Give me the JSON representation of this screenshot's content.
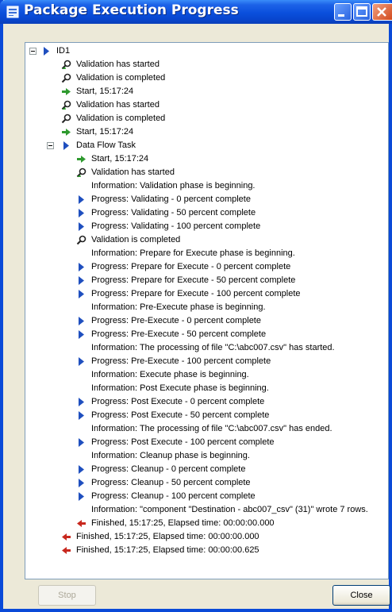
{
  "window": {
    "title": "Package Execution Progress"
  },
  "buttons": {
    "stop": "Stop",
    "close": "Close"
  },
  "tree": [
    {
      "icon": "expander-minus",
      "arrow": "blue-arrow-icon",
      "text": "ID1"
    },
    {
      "icon": "validation-start-icon",
      "text": "Validation has started"
    },
    {
      "icon": "validation-complete-icon",
      "text": "Validation is completed"
    },
    {
      "icon": "start-arrow-icon",
      "text": "Start, 15:17:24"
    },
    {
      "icon": "validation-start-icon",
      "text": "Validation has started"
    },
    {
      "icon": "validation-complete-icon",
      "text": "Validation is completed"
    },
    {
      "icon": "start-arrow-icon",
      "text": "Start, 15:17:24"
    },
    {
      "icon": "expander-minus",
      "arrow": "blue-arrow-icon",
      "text": "Data Flow Task"
    },
    {
      "icon": "start-arrow-icon",
      "text": "Start, 15:17:24"
    },
    {
      "icon": "validation-start-icon",
      "text": "Validation has started"
    },
    {
      "icon": "none",
      "text": "Information: Validation phase is beginning."
    },
    {
      "icon": "progress-arrow-icon",
      "text": "Progress: Validating - 0 percent complete"
    },
    {
      "icon": "progress-arrow-icon",
      "text": "Progress: Validating - 50 percent complete"
    },
    {
      "icon": "progress-arrow-icon",
      "text": "Progress: Validating - 100 percent complete"
    },
    {
      "icon": "validation-complete-icon",
      "text": "Validation is completed"
    },
    {
      "icon": "none",
      "text": "Information: Prepare for Execute phase is beginning."
    },
    {
      "icon": "progress-arrow-icon",
      "text": "Progress: Prepare for Execute - 0 percent complete"
    },
    {
      "icon": "progress-arrow-icon",
      "text": "Progress: Prepare for Execute - 50 percent complete"
    },
    {
      "icon": "progress-arrow-icon",
      "text": "Progress: Prepare for Execute - 100 percent complete"
    },
    {
      "icon": "none",
      "text": "Information: Pre-Execute phase is beginning."
    },
    {
      "icon": "progress-arrow-icon",
      "text": "Progress: Pre-Execute - 0 percent complete"
    },
    {
      "icon": "progress-arrow-icon",
      "text": "Progress: Pre-Execute - 50 percent complete"
    },
    {
      "icon": "none",
      "text": "Information: The processing of file \"C:\\abc007.csv\" has started."
    },
    {
      "icon": "progress-arrow-icon",
      "text": "Progress: Pre-Execute - 100 percent complete"
    },
    {
      "icon": "none",
      "text": "Information: Execute phase is beginning."
    },
    {
      "icon": "none",
      "text": "Information: Post Execute phase is beginning."
    },
    {
      "icon": "progress-arrow-icon",
      "text": "Progress: Post Execute - 0 percent complete"
    },
    {
      "icon": "progress-arrow-icon",
      "text": "Progress: Post Execute - 50 percent complete"
    },
    {
      "icon": "none",
      "text": "Information: The processing of file \"C:\\abc007.csv\" has ended."
    },
    {
      "icon": "progress-arrow-icon",
      "text": "Progress: Post Execute - 100 percent complete"
    },
    {
      "icon": "none",
      "text": "Information: Cleanup phase is beginning."
    },
    {
      "icon": "progress-arrow-icon",
      "text": "Progress: Cleanup - 0 percent complete"
    },
    {
      "icon": "progress-arrow-icon",
      "text": "Progress: Cleanup - 50 percent complete"
    },
    {
      "icon": "progress-arrow-icon",
      "text": "Progress: Cleanup - 100 percent complete"
    },
    {
      "icon": "none",
      "text": "Information: \"component \"Destination - abc007_csv\" (31)\" wrote 7 rows."
    },
    {
      "icon": "finished-arrow-icon",
      "text": "Finished, 15:17:25, Elapsed time: 00:00:00.000"
    },
    {
      "icon": "finished-arrow-icon",
      "text": "Finished, 15:17:25, Elapsed time: 00:00:00.000"
    },
    {
      "icon": "finished-arrow-icon",
      "text": "Finished, 15:17:25, Elapsed time: 00:00:00.625"
    }
  ],
  "colors": {
    "titlebar": "#0a4fdc",
    "progress_arrow": "#1f4fbf",
    "start_arrow": "#2f9a2f",
    "finished_arrow": "#c8281e"
  }
}
